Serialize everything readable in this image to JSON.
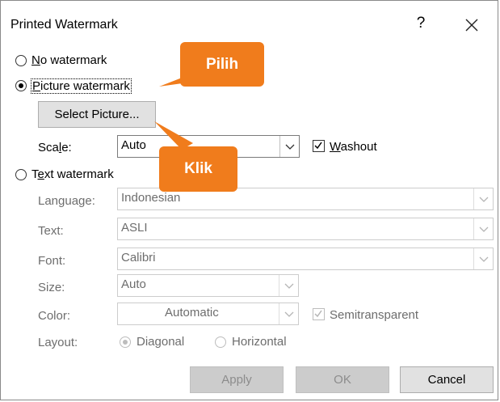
{
  "window": {
    "title": "Printed Watermark",
    "help_label": "?"
  },
  "options": {
    "no_watermark": "No watermark",
    "picture_watermark": "Picture watermark",
    "text_watermark": "Text watermark"
  },
  "picture": {
    "select_button": "Select Picture...",
    "scale_label": "Scale:",
    "scale_value": "Auto",
    "washout_label": "Washout",
    "washout_checked": true
  },
  "text": {
    "language_label": "Language:",
    "language_value": "Indonesian",
    "text_label": "Text:",
    "text_value": "ASLI",
    "font_label": "Font:",
    "font_value": "Calibri",
    "size_label": "Size:",
    "size_value": "Auto",
    "color_label": "Color:",
    "color_value": "Automatic",
    "semitransparent_label": "Semitransparent",
    "semitransparent_checked": true,
    "layout_label": "Layout:",
    "layout_diagonal": "Diagonal",
    "layout_horizontal": "Horizontal"
  },
  "buttons": {
    "apply": "Apply",
    "ok": "OK",
    "cancel": "Cancel"
  },
  "callouts": {
    "pilih": "Pilih",
    "klik": "Klik"
  },
  "colors": {
    "callout": "#f07c1c",
    "disabled_text": "#8c8c8c"
  }
}
